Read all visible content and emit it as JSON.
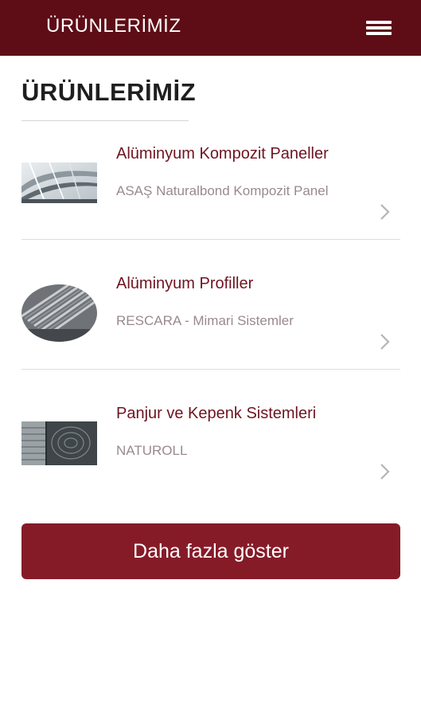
{
  "header": {
    "title": "ÜRÜNLERİMİZ",
    "menu_icon": "hamburger-menu-icon",
    "background_color": "#5e0d16"
  },
  "main": {
    "page_title": "ÜRÜNLERİMİZ",
    "products": [
      {
        "name": "Alüminyum Kompozit Paneller",
        "subtitle": "ASAŞ Naturalbond Kompozit Panel",
        "image": "composite-panel-building-photo",
        "chevron_icon": "chevron-right-icon"
      },
      {
        "name": "Alüminyum Profiller",
        "subtitle": "RESCARA - Mimari Sistemler",
        "image": "aluminum-profiles-photo",
        "chevron_icon": "chevron-right-icon"
      },
      {
        "name": "Panjur ve Kepenk Sistemleri",
        "subtitle": "NATUROLL",
        "image": "shutter-systems-photo",
        "chevron_icon": "chevron-right-icon"
      }
    ],
    "more_button_label": "Daha fazla göster"
  },
  "colors": {
    "accent": "#861b28",
    "product_name": "#6e1421",
    "subtitle": "#9a8a8c"
  }
}
